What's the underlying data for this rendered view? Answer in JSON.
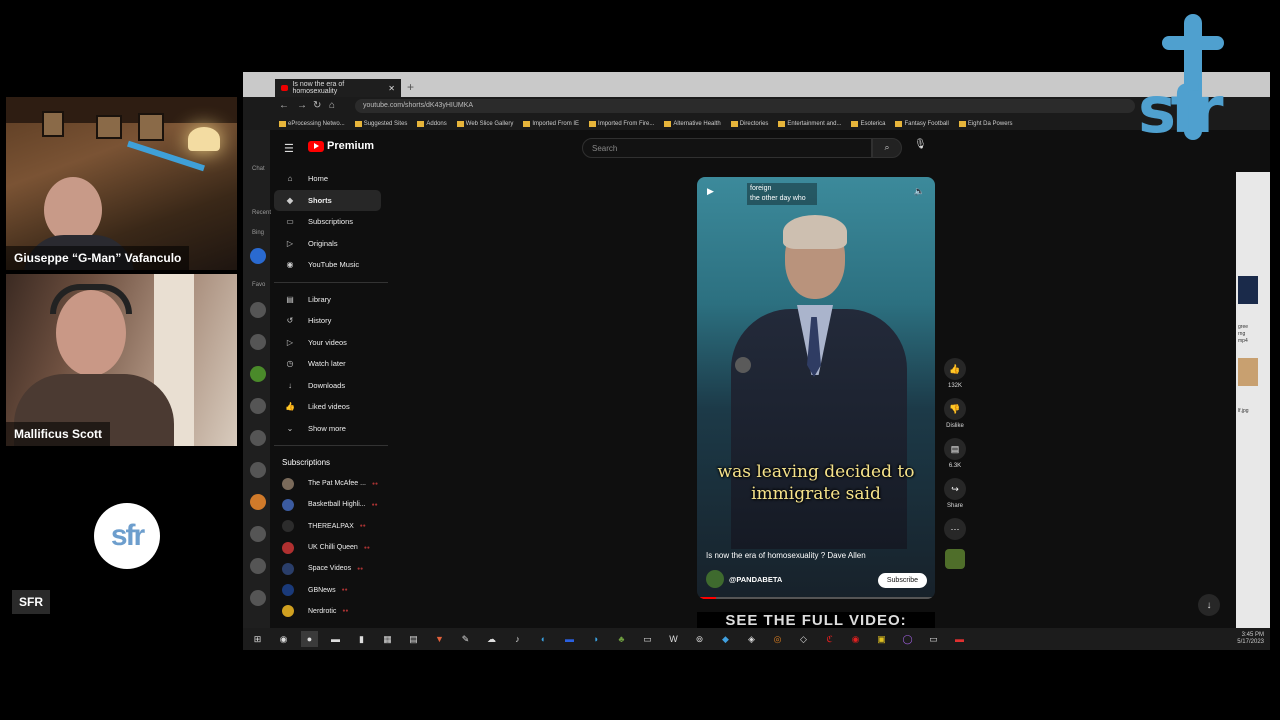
{
  "participants": [
    {
      "name": "Giuseppe “G-Man” Vafanculo"
    },
    {
      "name": "Mallificus Scott"
    },
    {
      "name": "SFR",
      "badge": "sfr"
    }
  ],
  "corner_logo": "sfr",
  "browser": {
    "tab_title": "Is now the era of homosexuality",
    "url": "youtube.com/shorts/dK43yHIUMKA",
    "bookmarks": [
      "eProcessing Netwo...",
      "Suggested Sites",
      "Addons",
      "Web Slice Gallery",
      "Imported From IE",
      "Imported From Fire...",
      "Alternative Health",
      "Directories",
      "Entertainment and...",
      "Esoterica",
      "Fantasy Football",
      "Eight Da Powers"
    ]
  },
  "edge_sidebar": {
    "labels": [
      "Chat",
      "Recent",
      "Bing",
      "Favo"
    ]
  },
  "youtube": {
    "logo_text": "Premium",
    "search_placeholder": "Search",
    "nav_items": [
      {
        "label": "Home",
        "icon": "home-icon"
      },
      {
        "label": "Shorts",
        "icon": "shorts-icon"
      },
      {
        "label": "Subscriptions",
        "icon": "subscriptions-icon"
      },
      {
        "label": "Originals",
        "icon": "originals-icon"
      },
      {
        "label": "YouTube Music",
        "icon": "music-icon"
      }
    ],
    "library_items": [
      {
        "label": "Library",
        "icon": "library-icon"
      },
      {
        "label": "History",
        "icon": "history-icon"
      },
      {
        "label": "Your videos",
        "icon": "your-videos-icon"
      },
      {
        "label": "Watch later",
        "icon": "watch-later-icon"
      },
      {
        "label": "Downloads",
        "icon": "download-icon"
      },
      {
        "label": "Liked videos",
        "icon": "thumbs-up-icon"
      },
      {
        "label": "Show more",
        "icon": "chevron-down-icon"
      }
    ],
    "subscriptions_heading": "Subscriptions",
    "subscriptions": [
      {
        "label": "The Pat McAfee ...",
        "color": "#7a6a5a"
      },
      {
        "label": "Basketball Highli...",
        "color": "#3b5ba0"
      },
      {
        "label": "THEREALPAX",
        "color": "#2c2c2c"
      },
      {
        "label": "UK Chilli Queen",
        "color": "#b03030"
      },
      {
        "label": "Space Videos",
        "color": "#2a3e6a"
      },
      {
        "label": "GBNews",
        "color": "#1a3a7a"
      },
      {
        "label": "Nerdrotic",
        "color": "#d0a020"
      }
    ],
    "short": {
      "top_caption_line1": "foreign",
      "top_caption_line2": "the other day who",
      "subtitle_line1": "was leaving decided to",
      "subtitle_line2": "immigrate said",
      "title": "Is now the era of homosexuality ? Dave Allen",
      "channel": "@PANDABETA",
      "subscribe_label": "Subscribe",
      "progress": 0.08,
      "below_text": "SEE THE FULL VIDEO:"
    },
    "actions": [
      {
        "icon": "thumbs-up-icon",
        "label": "132K"
      },
      {
        "icon": "thumbs-down-icon",
        "label": "Dislike"
      },
      {
        "icon": "comment-icon",
        "label": "6.3K"
      },
      {
        "icon": "share-icon",
        "label": "Share"
      },
      {
        "icon": "more-icon",
        "label": ""
      }
    ]
  },
  "desktop_right": {
    "labels": [
      "gree",
      "rng",
      "mp4",
      "lf.jpg"
    ]
  },
  "taskbar": {
    "time": "3:45 PM",
    "date": "5/17/2023"
  }
}
